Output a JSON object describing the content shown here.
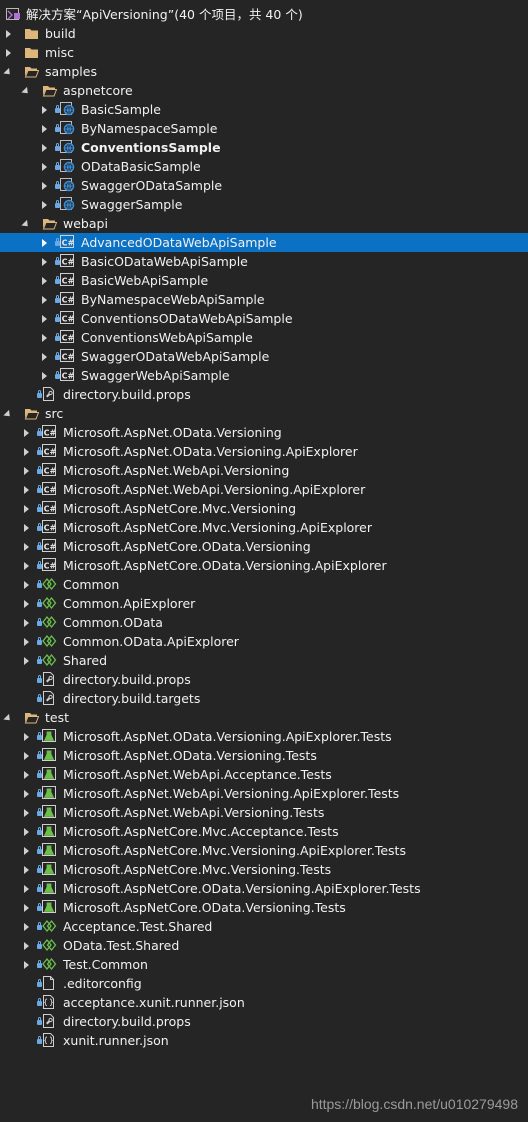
{
  "solution": {
    "title": "解决方案“ApiVersioning”(40 个项目，共 40 个)"
  },
  "tree": [
    {
      "label": "build",
      "depth": 1,
      "state": "closed",
      "icon": "folder-icon",
      "lock": false
    },
    {
      "label": "misc",
      "depth": 1,
      "state": "closed",
      "icon": "folder-icon",
      "lock": false
    },
    {
      "label": "samples",
      "depth": 1,
      "state": "open",
      "icon": "folder-open-icon",
      "lock": false
    },
    {
      "label": "aspnetcore",
      "depth": 2,
      "state": "open",
      "icon": "folder-open-icon",
      "lock": false
    },
    {
      "label": "BasicSample",
      "depth": 3,
      "state": "closed",
      "icon": "web-project-icon",
      "lock": true
    },
    {
      "label": "ByNamespaceSample",
      "depth": 3,
      "state": "closed",
      "icon": "web-project-icon",
      "lock": true
    },
    {
      "label": "ConventionsSample",
      "depth": 3,
      "state": "closed",
      "icon": "web-project-icon",
      "lock": true,
      "bold": true
    },
    {
      "label": "ODataBasicSample",
      "depth": 3,
      "state": "closed",
      "icon": "web-project-icon",
      "lock": true
    },
    {
      "label": "SwaggerODataSample",
      "depth": 3,
      "state": "closed",
      "icon": "web-project-icon",
      "lock": true
    },
    {
      "label": "SwaggerSample",
      "depth": 3,
      "state": "closed",
      "icon": "web-project-icon",
      "lock": true
    },
    {
      "label": "webapi",
      "depth": 2,
      "state": "open",
      "icon": "folder-open-icon",
      "lock": false
    },
    {
      "label": "AdvancedODataWebApiSample",
      "depth": 3,
      "state": "closed",
      "icon": "csharp-project-icon",
      "lock": true,
      "selected": true
    },
    {
      "label": "BasicODataWebApiSample",
      "depth": 3,
      "state": "closed",
      "icon": "csharp-project-icon",
      "lock": true
    },
    {
      "label": "BasicWebApiSample",
      "depth": 3,
      "state": "closed",
      "icon": "csharp-project-icon",
      "lock": true
    },
    {
      "label": "ByNamespaceWebApiSample",
      "depth": 3,
      "state": "closed",
      "icon": "csharp-project-icon",
      "lock": true
    },
    {
      "label": "ConventionsODataWebApiSample",
      "depth": 3,
      "state": "closed",
      "icon": "csharp-project-icon",
      "lock": true
    },
    {
      "label": "ConventionsWebApiSample",
      "depth": 3,
      "state": "closed",
      "icon": "csharp-project-icon",
      "lock": true
    },
    {
      "label": "SwaggerODataWebApiSample",
      "depth": 3,
      "state": "closed",
      "icon": "csharp-project-icon",
      "lock": true
    },
    {
      "label": "SwaggerWebApiSample",
      "depth": 3,
      "state": "closed",
      "icon": "csharp-project-icon",
      "lock": true
    },
    {
      "label": "directory.build.props",
      "depth": 2,
      "state": "none",
      "icon": "props-file-icon",
      "lock": true
    },
    {
      "label": "src",
      "depth": 1,
      "state": "open",
      "icon": "folder-open-icon",
      "lock": false
    },
    {
      "label": "Microsoft.AspNet.OData.Versioning",
      "depth": 2,
      "state": "closed",
      "icon": "csharp-project-icon",
      "lock": true
    },
    {
      "label": "Microsoft.AspNet.OData.Versioning.ApiExplorer",
      "depth": 2,
      "state": "closed",
      "icon": "csharp-project-icon",
      "lock": true
    },
    {
      "label": "Microsoft.AspNet.WebApi.Versioning",
      "depth": 2,
      "state": "closed",
      "icon": "csharp-project-icon",
      "lock": true
    },
    {
      "label": "Microsoft.AspNet.WebApi.Versioning.ApiExplorer",
      "depth": 2,
      "state": "closed",
      "icon": "csharp-project-icon",
      "lock": true
    },
    {
      "label": "Microsoft.AspNetCore.Mvc.Versioning",
      "depth": 2,
      "state": "closed",
      "icon": "csharp-project-icon",
      "lock": true
    },
    {
      "label": "Microsoft.AspNetCore.Mvc.Versioning.ApiExplorer",
      "depth": 2,
      "state": "closed",
      "icon": "csharp-project-icon",
      "lock": true
    },
    {
      "label": "Microsoft.AspNetCore.OData.Versioning",
      "depth": 2,
      "state": "closed",
      "icon": "csharp-project-icon",
      "lock": true
    },
    {
      "label": "Microsoft.AspNetCore.OData.Versioning.ApiExplorer",
      "depth": 2,
      "state": "closed",
      "icon": "csharp-project-icon",
      "lock": true
    },
    {
      "label": "Common",
      "depth": 2,
      "state": "closed",
      "icon": "shared-project-icon",
      "lock": true
    },
    {
      "label": "Common.ApiExplorer",
      "depth": 2,
      "state": "closed",
      "icon": "shared-project-icon",
      "lock": true
    },
    {
      "label": "Common.OData",
      "depth": 2,
      "state": "closed",
      "icon": "shared-project-icon",
      "lock": true
    },
    {
      "label": "Common.OData.ApiExplorer",
      "depth": 2,
      "state": "closed",
      "icon": "shared-project-icon",
      "lock": true
    },
    {
      "label": "Shared",
      "depth": 2,
      "state": "closed",
      "icon": "shared-project-icon",
      "lock": true
    },
    {
      "label": "directory.build.props",
      "depth": 2,
      "state": "none",
      "icon": "props-file-icon",
      "lock": true
    },
    {
      "label": "directory.build.targets",
      "depth": 2,
      "state": "none",
      "icon": "props-file-icon",
      "lock": true
    },
    {
      "label": "test",
      "depth": 1,
      "state": "open",
      "icon": "folder-open-icon",
      "lock": false
    },
    {
      "label": "Microsoft.AspNet.OData.Versioning.ApiExplorer.Tests",
      "depth": 2,
      "state": "closed",
      "icon": "test-project-icon",
      "lock": true
    },
    {
      "label": "Microsoft.AspNet.OData.Versioning.Tests",
      "depth": 2,
      "state": "closed",
      "icon": "test-project-icon",
      "lock": true
    },
    {
      "label": "Microsoft.AspNet.WebApi.Acceptance.Tests",
      "depth": 2,
      "state": "closed",
      "icon": "test-project-icon",
      "lock": true
    },
    {
      "label": "Microsoft.AspNet.WebApi.Versioning.ApiExplorer.Tests",
      "depth": 2,
      "state": "closed",
      "icon": "test-project-icon",
      "lock": true
    },
    {
      "label": "Microsoft.AspNet.WebApi.Versioning.Tests",
      "depth": 2,
      "state": "closed",
      "icon": "test-project-icon",
      "lock": true
    },
    {
      "label": "Microsoft.AspNetCore.Mvc.Acceptance.Tests",
      "depth": 2,
      "state": "closed",
      "icon": "test-project-icon",
      "lock": true
    },
    {
      "label": "Microsoft.AspNetCore.Mvc.Versioning.ApiExplorer.Tests",
      "depth": 2,
      "state": "closed",
      "icon": "test-project-icon",
      "lock": true
    },
    {
      "label": "Microsoft.AspNetCore.Mvc.Versioning.Tests",
      "depth": 2,
      "state": "closed",
      "icon": "test-project-icon",
      "lock": true
    },
    {
      "label": "Microsoft.AspNetCore.OData.Versioning.ApiExplorer.Tests",
      "depth": 2,
      "state": "closed",
      "icon": "test-project-icon",
      "lock": true
    },
    {
      "label": "Microsoft.AspNetCore.OData.Versioning.Tests",
      "depth": 2,
      "state": "closed",
      "icon": "test-project-icon",
      "lock": true
    },
    {
      "label": "Acceptance.Test.Shared",
      "depth": 2,
      "state": "closed",
      "icon": "shared-project-icon",
      "lock": true
    },
    {
      "label": "OData.Test.Shared",
      "depth": 2,
      "state": "closed",
      "icon": "shared-project-icon",
      "lock": true
    },
    {
      "label": "Test.Common",
      "depth": 2,
      "state": "closed",
      "icon": "shared-project-icon",
      "lock": true
    },
    {
      "label": ".editorconfig",
      "depth": 2,
      "state": "none",
      "icon": "file-icon",
      "lock": true
    },
    {
      "label": "acceptance.xunit.runner.json",
      "depth": 2,
      "state": "none",
      "icon": "json-file-icon",
      "lock": true
    },
    {
      "label": "directory.build.props",
      "depth": 2,
      "state": "none",
      "icon": "props-file-icon",
      "lock": true
    },
    {
      "label": "xunit.runner.json",
      "depth": 2,
      "state": "none",
      "icon": "json-file-icon",
      "lock": true
    }
  ],
  "watermark": "https://blog.csdn.net/u010279498",
  "colors": {
    "background": "#252526",
    "selection": "#0b71c4",
    "folder": "#dcb67a",
    "web": "#3c8fd6",
    "csharp": "#d9d9d9",
    "shared": "#6cc04a",
    "test": "#6cc04a",
    "lock": "#6aa8e6"
  }
}
